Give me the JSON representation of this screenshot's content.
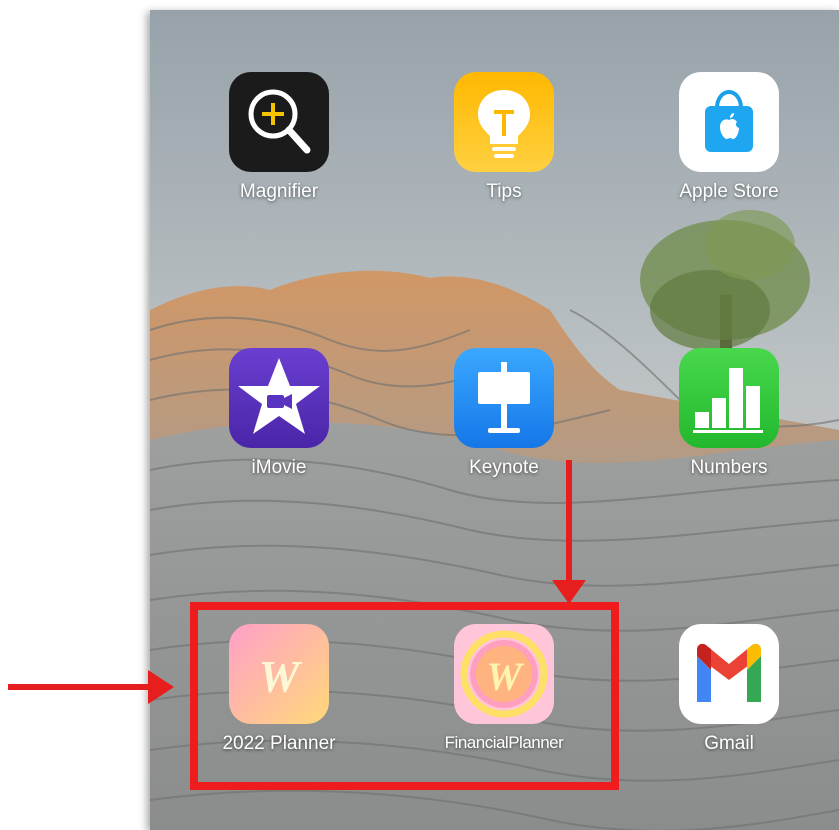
{
  "apps": [
    {
      "label": "Magnifier",
      "icon": "magnifier-icon"
    },
    {
      "label": "Tips",
      "icon": "tips-lightbulb-icon"
    },
    {
      "label": "Apple Store",
      "icon": "apple-store-bag-icon"
    },
    {
      "label": "iMovie",
      "icon": "imovie-star-icon"
    },
    {
      "label": "Keynote",
      "icon": "keynote-podium-icon"
    },
    {
      "label": "Numbers",
      "icon": "numbers-bar-chart-icon"
    },
    {
      "label": "2022 Planner",
      "icon": "planner-w-icon"
    },
    {
      "label": "FinancialPlanner",
      "icon": "financial-planner-w-icon"
    },
    {
      "label": "Gmail",
      "icon": "gmail-m-icon"
    }
  ],
  "annotation": {
    "highlight_color": "#ee1c1c"
  }
}
